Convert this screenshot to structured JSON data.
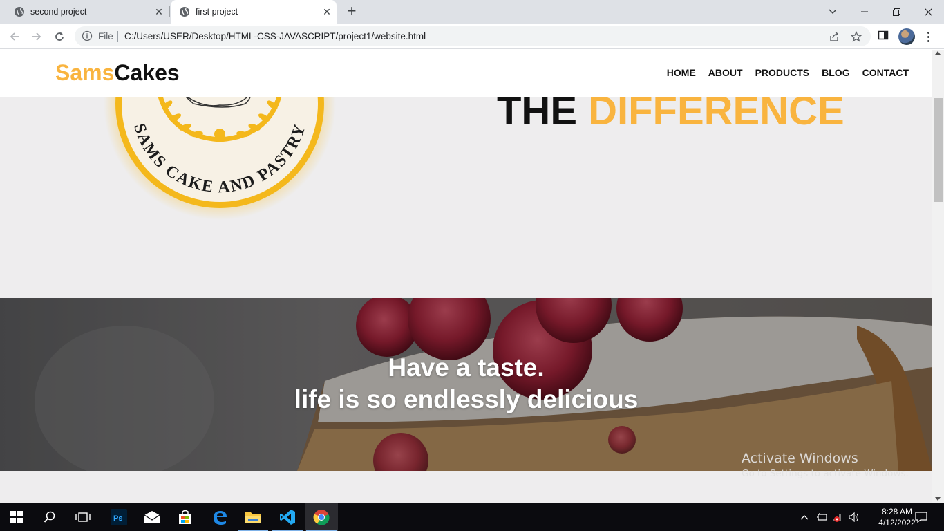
{
  "browser": {
    "tabs": [
      {
        "title": "second project",
        "active": false
      },
      {
        "title": "first project",
        "active": true
      }
    ],
    "address": {
      "scheme_label": "File",
      "url": "C:/Users/USER/Desktop/HTML-CSS-JAVASCRIPT/project1/website.html"
    }
  },
  "site": {
    "brand": {
      "part1": "Sams",
      "part2": "Cakes"
    },
    "nav": [
      "HOME",
      "ABOUT",
      "PRODUCTS",
      "BLOG",
      "CONTACT"
    ],
    "hero": {
      "title_part1": "THE",
      "title_part2": "DIFFERENCE"
    },
    "logo_text": "SAMS CAKE AND PASTRY",
    "band": {
      "line1": "Have a taste.",
      "line2": "life is so endlessly delicious"
    },
    "colors": {
      "accent": "#f9b43f",
      "text": "#111111",
      "background": "#eeedee"
    }
  },
  "os": {
    "watermark_title": "Activate Windows",
    "watermark_sub": "Go to Settings to activate Windows.",
    "clock_time": "8:28 AM",
    "clock_date": "4/12/2022",
    "taskbar_apps": [
      "start-icon",
      "search-icon",
      "task-view-icon",
      "photoshop-icon",
      "mail-icon",
      "store-icon",
      "edge-icon",
      "file-explorer-icon",
      "vscode-icon",
      "chrome-icon"
    ]
  }
}
